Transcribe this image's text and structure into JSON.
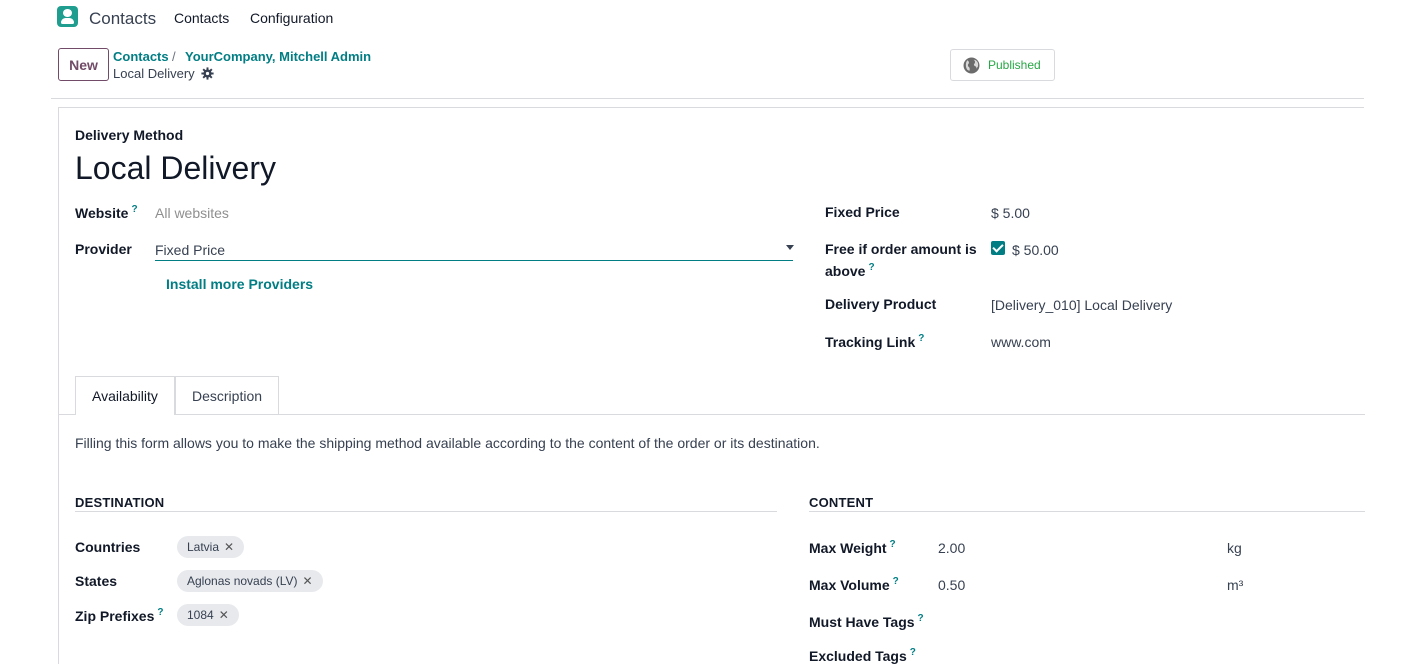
{
  "app": {
    "name": "Contacts",
    "menu": [
      "Contacts",
      "Configuration"
    ]
  },
  "control": {
    "new_label": "New",
    "breadcrumb": [
      "Contacts",
      "YourCompany, Mitchell Admin"
    ],
    "breadcrumb_sep": "/",
    "current": "Local Delivery",
    "published_label": "Published"
  },
  "form": {
    "type_label": "Delivery Method",
    "name": "Local Delivery",
    "website": {
      "label": "Website",
      "help": "?",
      "placeholder": "All websites"
    },
    "provider": {
      "label": "Provider",
      "value": "Fixed Price"
    },
    "install_link": "Install more Providers",
    "fixed_price": {
      "label": "Fixed Price",
      "value": "$ 5.00"
    },
    "free_if": {
      "label_line1": "Free if order amount is",
      "label_line2": "above",
      "help": "?",
      "checked": true,
      "value": "$ 50.00"
    },
    "delivery_product": {
      "label": "Delivery Product",
      "value": "[Delivery_010] Local Delivery"
    },
    "tracking_link": {
      "label": "Tracking Link",
      "help": "?",
      "value": "www.com"
    }
  },
  "tabs": [
    {
      "label": "Availability",
      "active": true
    },
    {
      "label": "Description",
      "active": false
    }
  ],
  "availability": {
    "intro": "Filling this form allows you to make the shipping method available according to the content of the order or its destination.",
    "destination": {
      "title": "DESTINATION",
      "countries": {
        "label": "Countries",
        "tags": [
          "Latvia"
        ]
      },
      "states": {
        "label": "States",
        "tags": [
          "Aglonas novads (LV)"
        ]
      },
      "zip": {
        "label": "Zip Prefixes",
        "help": "?",
        "tags": [
          "1084"
        ]
      }
    },
    "content": {
      "title": "CONTENT",
      "max_weight": {
        "label": "Max Weight",
        "help": "?",
        "value": "2.00",
        "unit": "kg"
      },
      "max_volume": {
        "label": "Max Volume",
        "help": "?",
        "value": "0.50",
        "unit": "m³"
      },
      "must_have_tags": {
        "label": "Must Have Tags",
        "help": "?"
      },
      "excluded_tags": {
        "label": "Excluded Tags",
        "help": "?"
      }
    }
  },
  "colors": {
    "accent": "#017e84",
    "brand": "#714b67",
    "published": "#28a745"
  },
  "icons": {
    "app": "contacts-app-icon",
    "gear": "gear-icon",
    "globe": "globe-icon",
    "remove": "close-icon"
  }
}
